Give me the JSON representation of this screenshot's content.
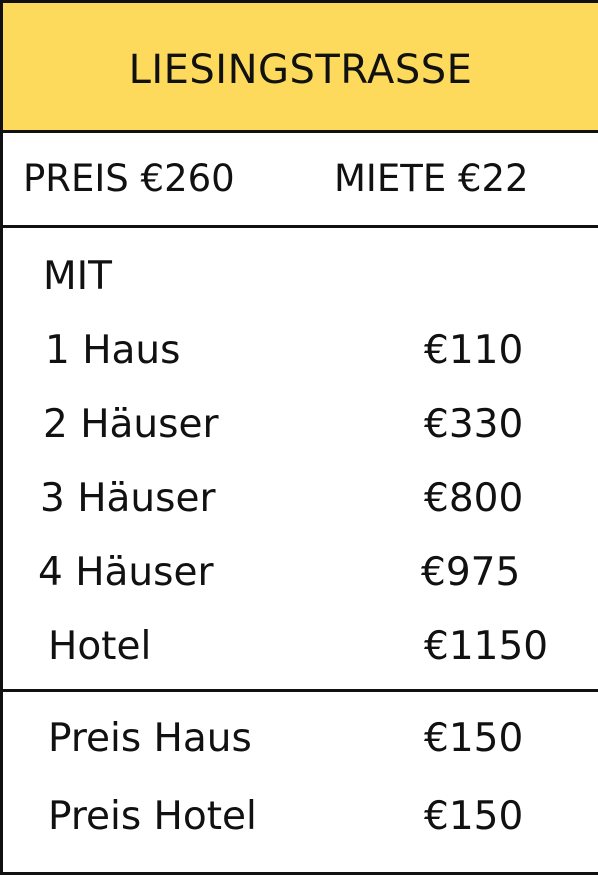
{
  "card": {
    "title": "LIESINGSTRASSE",
    "header_color": "#FDDA5B",
    "price_text": "PREIS €260",
    "rent_text": "MIETE €22"
  },
  "rent_table": {
    "header": "MIT",
    "rows": [
      {
        "label": "1 Haus",
        "value": "€110"
      },
      {
        "label": "2 Häuser",
        "value": "€330"
      },
      {
        "label": "3 Häuser",
        "value": "€800"
      },
      {
        "label": "4 Häuser",
        "value": "€975"
      },
      {
        "label": "Hotel",
        "value": "€1150"
      }
    ]
  },
  "costs": {
    "rows": [
      {
        "label": "Preis Haus",
        "value": "€150"
      },
      {
        "label": "Preis Hotel",
        "value": "€150"
      }
    ]
  }
}
